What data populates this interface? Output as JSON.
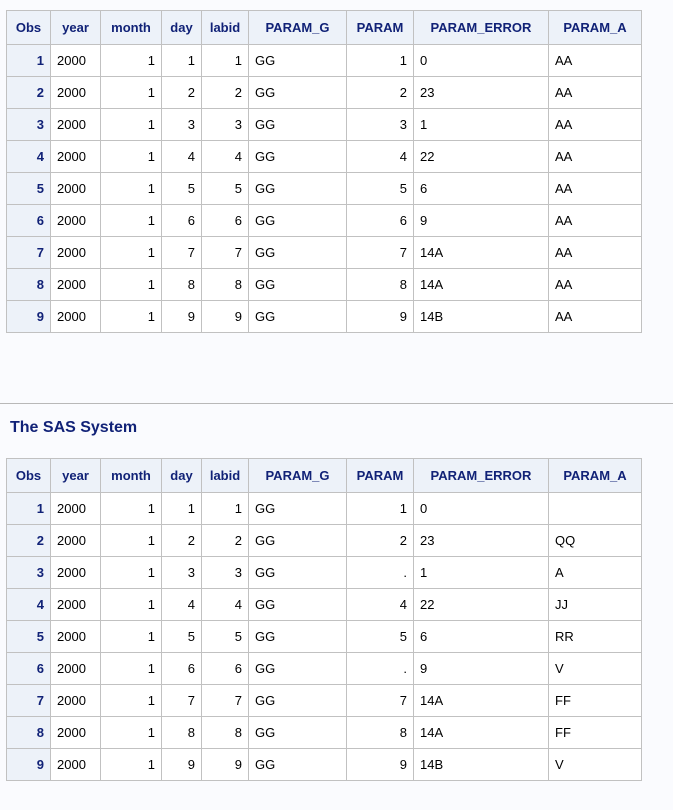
{
  "columns": [
    "Obs",
    "year",
    "month",
    "day",
    "labid",
    "PARAM_G",
    "PARAM",
    "PARAM_ERROR",
    "PARAM_A"
  ],
  "table1": [
    [
      "1",
      "2000",
      "1",
      "1",
      "1",
      "GG",
      "1",
      "0",
      "AA"
    ],
    [
      "2",
      "2000",
      "1",
      "2",
      "2",
      "GG",
      "2",
      "23",
      "AA"
    ],
    [
      "3",
      "2000",
      "1",
      "3",
      "3",
      "GG",
      "3",
      "1",
      "AA"
    ],
    [
      "4",
      "2000",
      "1",
      "4",
      "4",
      "GG",
      "4",
      "22",
      "AA"
    ],
    [
      "5",
      "2000",
      "1",
      "5",
      "5",
      "GG",
      "5",
      "6",
      "AA"
    ],
    [
      "6",
      "2000",
      "1",
      "6",
      "6",
      "GG",
      "6",
      "9",
      "AA"
    ],
    [
      "7",
      "2000",
      "1",
      "7",
      "7",
      "GG",
      "7",
      "14A",
      "AA"
    ],
    [
      "8",
      "2000",
      "1",
      "8",
      "8",
      "GG",
      "8",
      "14A",
      "AA"
    ],
    [
      "9",
      "2000",
      "1",
      "9",
      "9",
      "GG",
      "9",
      "14B",
      "AA"
    ]
  ],
  "title": "The SAS System",
  "table2": [
    [
      "1",
      "2000",
      "1",
      "1",
      "1",
      "GG",
      "1",
      "0",
      ""
    ],
    [
      "2",
      "2000",
      "1",
      "2",
      "2",
      "GG",
      "2",
      "23",
      "QQ"
    ],
    [
      "3",
      "2000",
      "1",
      "3",
      "3",
      "GG",
      ".",
      "1",
      "A"
    ],
    [
      "4",
      "2000",
      "1",
      "4",
      "4",
      "GG",
      "4",
      "22",
      "JJ"
    ],
    [
      "5",
      "2000",
      "1",
      "5",
      "5",
      "GG",
      "5",
      "6",
      "RR"
    ],
    [
      "6",
      "2000",
      "1",
      "6",
      "6",
      "GG",
      ".",
      "9",
      "V"
    ],
    [
      "7",
      "2000",
      "1",
      "7",
      "7",
      "GG",
      "7",
      "14A",
      "FF"
    ],
    [
      "8",
      "2000",
      "1",
      "8",
      "8",
      "GG",
      "8",
      "14A",
      "FF"
    ],
    [
      "9",
      "2000",
      "1",
      "9",
      "9",
      "GG",
      "9",
      "14B",
      "V"
    ]
  ]
}
